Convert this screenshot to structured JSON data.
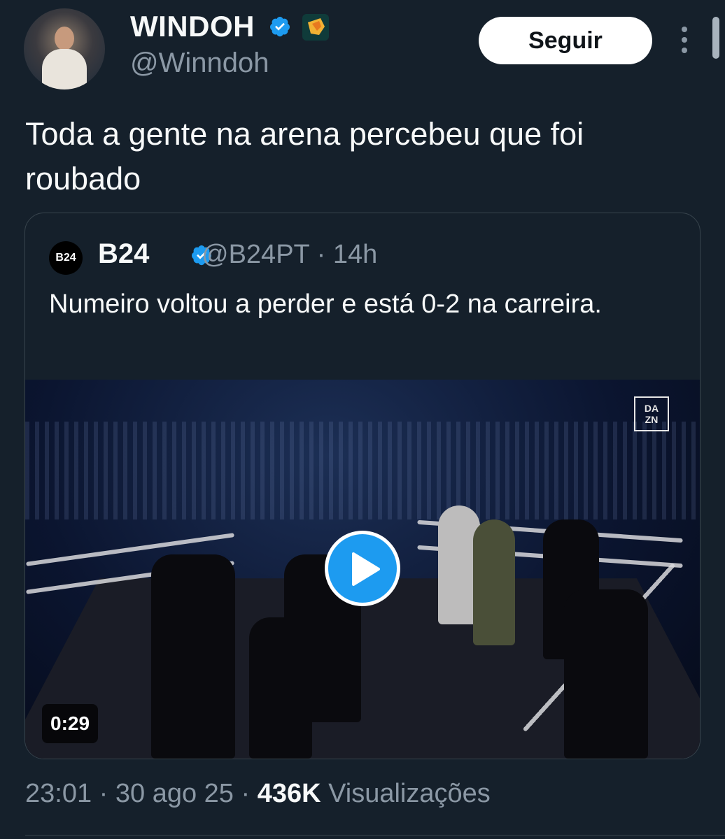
{
  "tweet": {
    "author": {
      "display_name": "WINDOH",
      "handle": "@Winndoh",
      "verified_icon": "verified-badge-icon",
      "affiliate_icon": "affiliate-badge-icon"
    },
    "follow_label": "Seguir",
    "text": "Toda a gente na arena percebeu que foi roubado",
    "footer": {
      "time": "23:01",
      "date": "30 ago 25",
      "views_count": "436K",
      "views_label": "Visualizações"
    }
  },
  "quote": {
    "avatar_text": "B24",
    "display_name": "B24",
    "handle": "@B24PT",
    "time": "14h",
    "text": "Numeiro voltou a perder e está 0-2 na carreira.",
    "media": {
      "watermark_top": "DA",
      "watermark_bottom": "ZN",
      "duration": "0:29",
      "play_icon": "play-icon"
    }
  },
  "colors": {
    "background": "#15202b",
    "accent": "#1d9bf0",
    "muted": "#8b98a5",
    "text": "#f7f9f9",
    "border": "#38444d"
  }
}
